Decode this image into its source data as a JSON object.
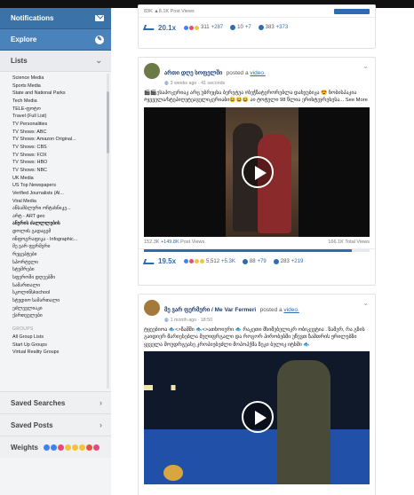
{
  "sidebar": {
    "notifications": "Notifications",
    "explore": "Explore",
    "lists_header": "Lists",
    "lists": [
      "Science Media",
      "Sports Media",
      "State and National Parks",
      "Tech Media",
      "TELE-ფოტო",
      "Travel (Full List)",
      "TV Personalities",
      "TV Shows: ABC",
      "TV Shows: Amazon Original...",
      "TV Shows: CBS",
      "TV Shows: FOX",
      "TV Shows: HBO",
      "TV Shows: NBC",
      "UK Media",
      "US Top Newspapers",
      "Verified Journalists (Al...",
      "Viral Media",
      "ანსამბლური ოჩტახნიკე...",
      "არტ - ART geo",
      "ანურის ძალლლების",
      "დოლის გადაცემ",
      "ინფოგრაფიკა - Infographic...",
      "მე ვარ ფერმერი",
      "რეცეპტები",
      "სპორტული",
      "სტუმრები",
      "სფეროში დღეებში",
      "სამართალი",
      "სკოლინსkschool",
      "სტუდიო სამართალი",
      "ეძლევლიაკი",
      "ქართველები"
    ],
    "bold_index": 19,
    "groups_label": "GROUPS",
    "groups": [
      "All Group Lists",
      "Start Up Groups",
      "Virtual Reality Groups"
    ],
    "saved_searches": "Saved Searches",
    "saved_posts": "Saved Posts",
    "weights": "Weights"
  },
  "top_card": {
    "stats_left": "83K ▲8.1K Post Views",
    "trend": "20.1x",
    "reactions": "311",
    "reactions_delta": "+287",
    "comments": "10",
    "comments_delta": "+7",
    "shares": "383",
    "shares_delta": "+373"
  },
  "post1": {
    "author": "ართი დღე სოფელში",
    "action": "posted a",
    "link": "video.",
    "meta": "3 weeks ago · 41 seconds",
    "text": "🎬🎬ესაპოკერიაკ არც უბრეცხა ბერეტუა #ბეჭზატერორებლა დახვებიკა 😍 ნობისპაკია #ყვველა/სტეპიღეტეაველიკერიაბი😆😆😆 აი ტოტული 98 წლია ერიხტეჯრეხესა... See More",
    "views_left": "152.3K",
    "views_left_delta": "+149.8K",
    "views_left_label": "Post Views",
    "views_right": "166.1K Total Views",
    "trend": "19.5x",
    "reactions": "5,512",
    "reactions_delta": "+5.3K",
    "comments": "88",
    "comments_delta": "+79",
    "shares": "283",
    "shares_delta": "+219"
  },
  "post2": {
    "author": "მე ვარ ფერმერი / Me Var Fermeri",
    "action": "posted a",
    "link": "video.",
    "meta": "1 month ago · 18:50",
    "text": "ტყეებიოა 🐟<>ზამში 🐟<>ათხოიერი 🐟 რაკეთი მხიშებელიკრ ობიკევტია . ზამერ, რა გზის გაიდიერ მარიესებლა მეღიფრგალი და როგორ პირობებში უწევთ ზამთრის ჟრილებზი ყვველა მოუდრგეასე კროპიებეძლი მოპოჰქმა ზეკი ბელიკ იტხში 🐟"
  },
  "colors": {
    "topbar": "#111111",
    "sidebar_blue": "#3b73a8",
    "link": "#2d6cb0"
  }
}
